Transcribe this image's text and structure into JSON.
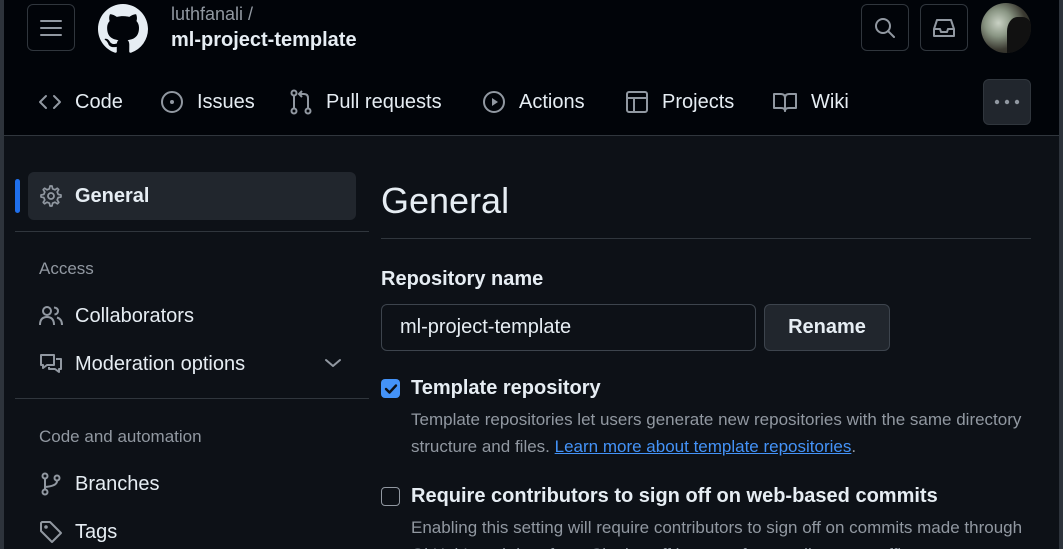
{
  "header": {
    "owner": "luthfanali /",
    "repo": "ml-project-template"
  },
  "nav": {
    "tabs": [
      {
        "label": "Code",
        "icon": "code-icon"
      },
      {
        "label": "Issues",
        "icon": "issue-opened-icon"
      },
      {
        "label": "Pull requests",
        "icon": "git-pull-request-icon"
      },
      {
        "label": "Actions",
        "icon": "play-icon"
      },
      {
        "label": "Projects",
        "icon": "table-icon"
      },
      {
        "label": "Wiki",
        "icon": "book-icon"
      }
    ]
  },
  "sidebar": {
    "active": "General",
    "access_heading": "Access",
    "items_access": [
      {
        "label": "Collaborators",
        "icon": "people-icon"
      },
      {
        "label": "Moderation options",
        "icon": "comment-discussion-icon"
      }
    ],
    "code_heading": "Code and automation",
    "items_code": [
      {
        "label": "Branches",
        "icon": "git-branch-icon"
      },
      {
        "label": "Tags",
        "icon": "tag-icon"
      }
    ]
  },
  "main": {
    "title": "General",
    "repo_name_label": "Repository name",
    "repo_name_value": "ml-project-template",
    "rename_label": "Rename",
    "template": {
      "checked": true,
      "title": "Template repository",
      "desc_1": "Template repositories let users generate new repositories with the same directory structure and files.",
      "link": "Learn more about template repositories",
      "desc_end": "."
    },
    "signoff": {
      "checked": false,
      "title": "Require contributors to sign off on web-based commits",
      "desc": "Enabling this setting will require contributors to sign off on commits made through GitHub's web interface. Signing off is a way for contributors to affirm"
    }
  },
  "colors": {
    "accent": "#1f6feb",
    "link": "#4493f8",
    "bg": "#0d1117",
    "header_bg": "#010409"
  }
}
